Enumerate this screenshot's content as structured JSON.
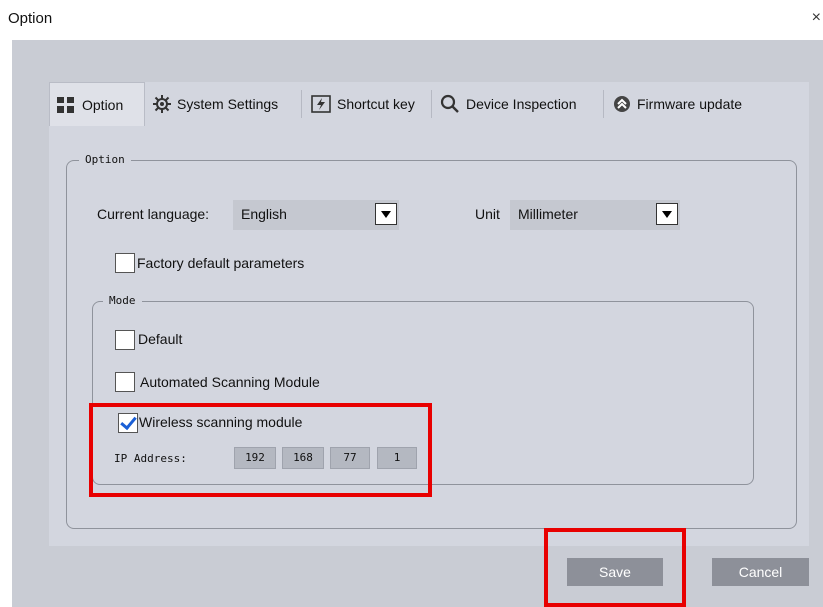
{
  "window": {
    "title": "Option",
    "close_glyph": "×"
  },
  "tabs": [
    {
      "label": "Option",
      "icon": "grid-icon",
      "active": true
    },
    {
      "label": "System Settings",
      "icon": "gear-icon"
    },
    {
      "label": "Shortcut key",
      "icon": "lightning-icon"
    },
    {
      "label": "Device Inspection",
      "icon": "search-icon"
    },
    {
      "label": "Firmware update",
      "icon": "firmware-icon"
    }
  ],
  "option_group": {
    "legend": "Option",
    "language_label": "Current language:",
    "language_value": "English",
    "unit_label": "Unit",
    "unit_value": "Millimeter",
    "factory_default_label": "Factory default parameters",
    "factory_default_checked": false
  },
  "mode_group": {
    "legend": "Mode",
    "options": [
      {
        "label": "Default",
        "checked": false
      },
      {
        "label": "Automated Scanning Module",
        "checked": false
      },
      {
        "label": "Wireless scanning module",
        "checked": true
      }
    ],
    "ip_label": "IP Address:",
    "ip_octets": [
      "192",
      "168",
      "77",
      "1"
    ]
  },
  "footer": {
    "save_label": "Save",
    "cancel_label": "Cancel"
  },
  "colors": {
    "highlight": "#e80000",
    "checkmark": "#1a5fd6",
    "button": "#8d9099",
    "panel": "#c9ccd4"
  }
}
